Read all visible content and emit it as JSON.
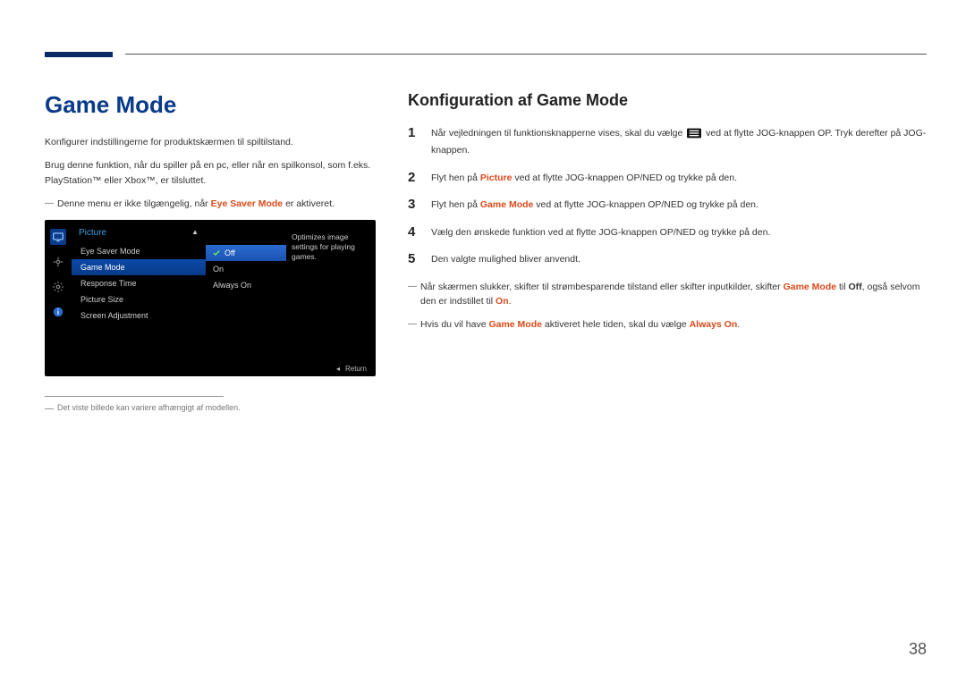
{
  "left": {
    "title": "Game Mode",
    "p1": "Konfigurer indstillingerne for produktskærmen til spiltilstand.",
    "p2": "Brug denne funktion, når du spiller på en pc, eller når en spilkonsol, som f.eks. PlayStation™ eller Xbox™, er tilsluttet.",
    "note1_a": "Denne menu er ikke tilgængelig, når ",
    "note1_hl": "Eye Saver Mode",
    "note1_b": " er aktiveret.",
    "caption": "Det viste billede kan variere afhængigt af modellen."
  },
  "osd": {
    "header": "Picture",
    "items": {
      "eyesaver": "Eye Saver Mode",
      "gamemode": "Game Mode",
      "response": "Response Time",
      "picsize": "Picture Size",
      "screenadj": "Screen Adjustment"
    },
    "values": {
      "off": "Off",
      "on": "On",
      "always": "Always On"
    },
    "desc": "Optimizes image settings for playing games.",
    "return": "Return"
  },
  "right": {
    "title": "Konfiguration af Game Mode",
    "steps": {
      "s1a": "Når vejledningen til funktionsknapperne vises, skal du vælge ",
      "s1b": " ved at flytte JOG-knappen OP. Tryk derefter på JOG-knappen.",
      "s2a": "Flyt hen på ",
      "s2hl": "Picture",
      "s2b": " ved at flytte JOG-knappen OP/NED og trykke på den.",
      "s3a": "Flyt hen på ",
      "s3hl": "Game Mode",
      "s3b": " ved at flytte JOG-knappen OP/NED og trykke på den.",
      "s4": "Vælg den ønskede funktion ved at flytte JOG-knappen OP/NED og trykke på den.",
      "s5": "Den valgte mulighed bliver anvendt."
    },
    "note1_a": "Når skærmen slukker, skifter til strømbesparende tilstand eller skifter inputkilder, skifter ",
    "note1_hl1": "Game Mode",
    "note1_b": " til ",
    "note1_hl2": "Off",
    "note1_c": ", også selvom den er indstillet til ",
    "note1_hl3": "On",
    "note1_d": ".",
    "note2_a": "Hvis du vil have ",
    "note2_hl1": "Game Mode",
    "note2_b": " aktiveret hele tiden, skal du vælge ",
    "note2_hl2": "Always On",
    "note2_c": "."
  },
  "page_number": "38"
}
